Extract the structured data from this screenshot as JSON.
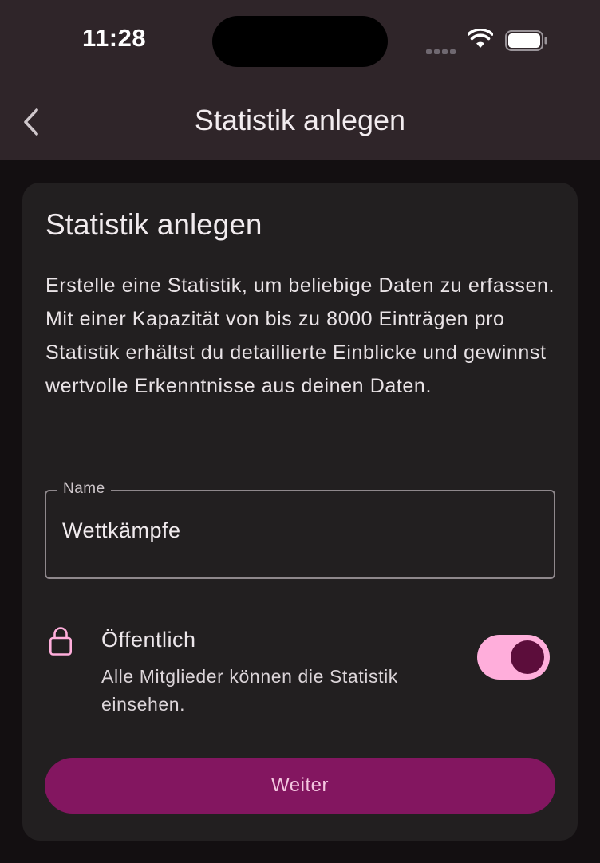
{
  "status_bar": {
    "time": "11:28",
    "icons": [
      "signal-icon",
      "wifi-icon",
      "battery-icon"
    ]
  },
  "nav": {
    "title": "Statistik anlegen",
    "back_icon": "chevron-left-icon"
  },
  "card": {
    "title": "Statistik anlegen",
    "description_lines": [
      "Erstelle eine Statistik, um beliebige Daten zu erfassen.",
      "Mit einer Kapazität von bis zu 8000 Einträgen pro Statistik erhältst du detaillierte Einblicke und gewinnst wertvolle Erkenntnisse aus deinen Daten."
    ],
    "name_field": {
      "label": "Name",
      "value": "Wettkämpfe"
    },
    "visibility": {
      "icon": "lock-icon",
      "title": "Öffentlich",
      "description": "Alle Mitglieder können die Statistik einsehen.",
      "enabled": true
    },
    "submit_label": "Weiter"
  },
  "colors": {
    "header_bg": "#2f2529",
    "page_bg": "#130f11",
    "card_bg": "#221f20",
    "accent_pink": "#ffaedb",
    "button_bg": "#831660",
    "button_text": "#f4c6e0"
  }
}
